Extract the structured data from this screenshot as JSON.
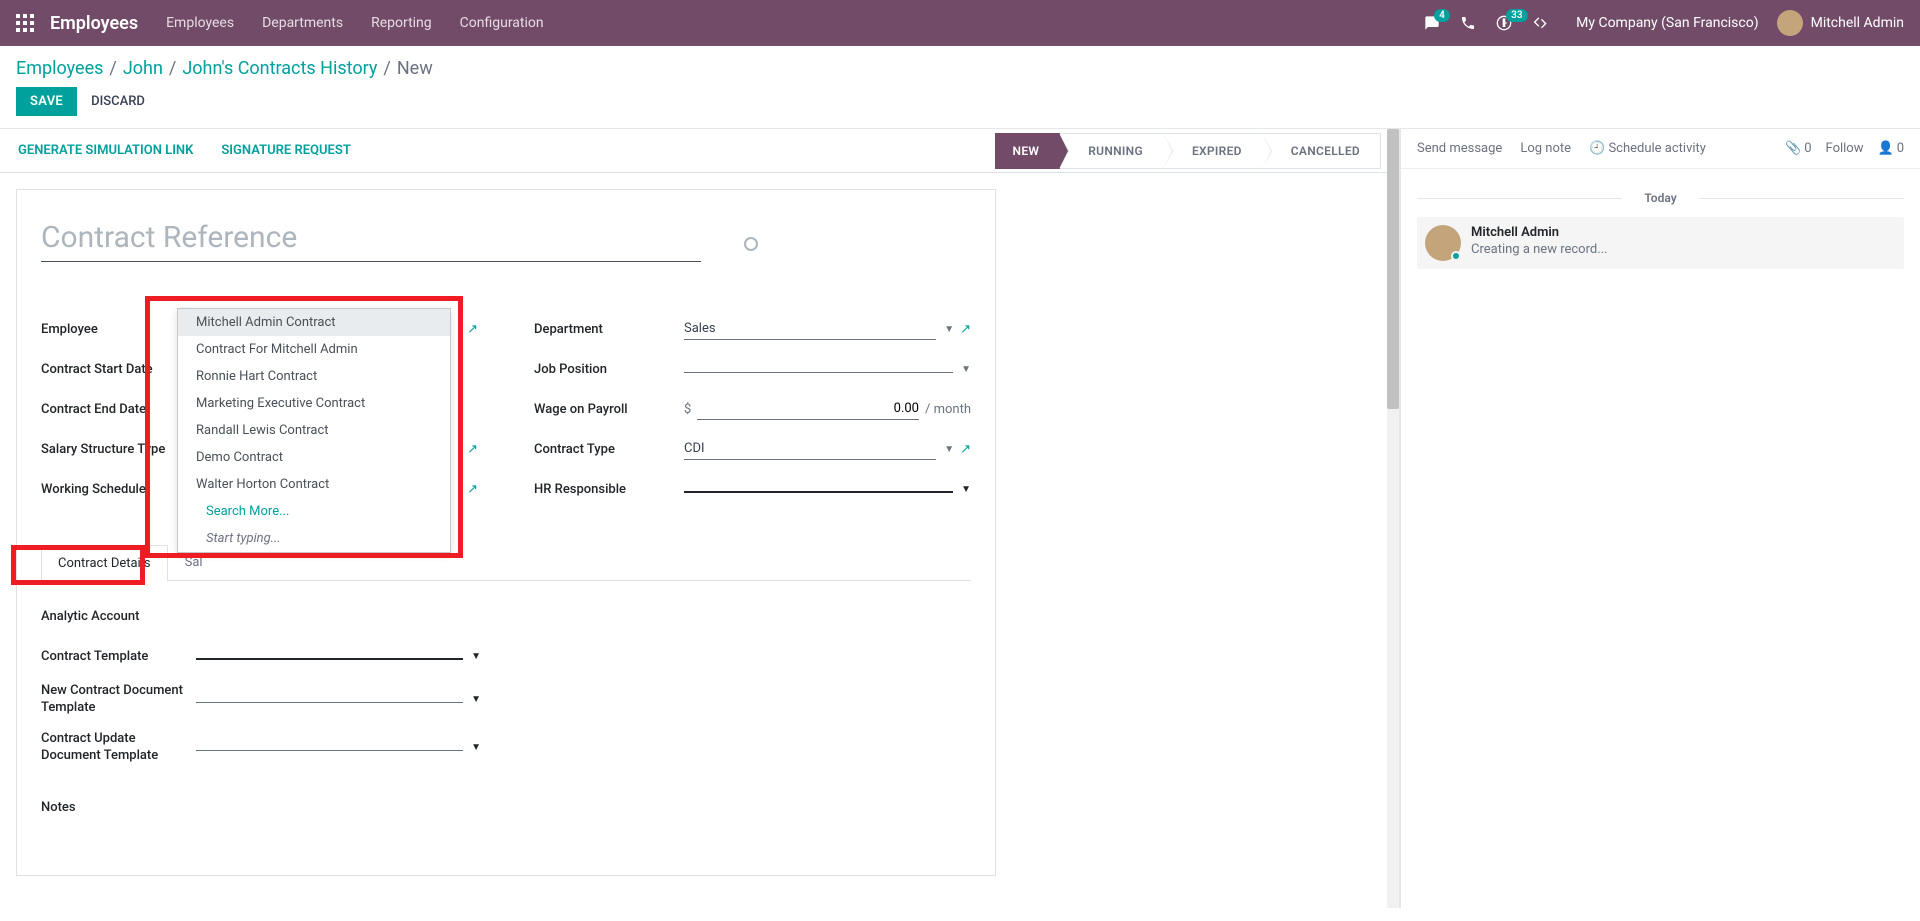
{
  "header": {
    "brand": "Employees",
    "menu": [
      "Employees",
      "Departments",
      "Reporting",
      "Configuration"
    ],
    "discuss_badge": "4",
    "activities_badge": "33",
    "company": "My Company (San Francisco)",
    "username": "Mitchell Admin"
  },
  "breadcrumb": {
    "items": [
      "Employees",
      "John",
      "John's Contracts History"
    ],
    "current": "New"
  },
  "buttons": {
    "save": "SAVE",
    "discard": "DISCARD",
    "gen_link": "GENERATE SIMULATION LINK",
    "sig_req": "SIGNATURE REQUEST"
  },
  "status": {
    "items": [
      "NEW",
      "RUNNING",
      "EXPIRED",
      "CANCELLED"
    ],
    "active_index": 0
  },
  "form": {
    "title_placeholder": "Contract Reference",
    "labels": {
      "employee": "Employee",
      "start_date": "Contract Start Date",
      "end_date": "Contract End Date",
      "salary_type": "Salary Structure Type",
      "working_schedule": "Working Schedule",
      "department": "Department",
      "job_position": "Job Position",
      "wage_payroll": "Wage on Payroll",
      "contract_type": "Contract Type",
      "hr_responsible": "HR Responsible",
      "analytic_account": "Analytic Account",
      "contract_template": "Contract Template",
      "new_contract_doc": "New Contract Document Template",
      "contract_update_doc": "Contract Update Document Template",
      "notes": "Notes"
    },
    "values": {
      "department": "Sales",
      "wage_payroll": "0.00",
      "wage_prefix": "$",
      "wage_suffix": "/ month",
      "contract_type": "CDI"
    },
    "tabs": [
      "Contract Details",
      "Sal"
    ]
  },
  "dropdown": {
    "items": [
      "Mitchell Admin Contract",
      "Contract For Mitchell Admin",
      "Ronnie Hart Contract",
      "Marketing Executive Contract",
      "Randall Lewis Contract",
      "Demo Contract",
      "Walter Horton Contract"
    ],
    "search_more": "Search More...",
    "hint": "Start typing..."
  },
  "chatter": {
    "send_message": "Send message",
    "log_note": "Log note",
    "schedule": "Schedule activity",
    "attach_count": "0",
    "follow": "Follow",
    "follower_count": "0",
    "divider": "Today",
    "log": {
      "name": "Mitchell Admin",
      "msg": "Creating a new record..."
    }
  }
}
